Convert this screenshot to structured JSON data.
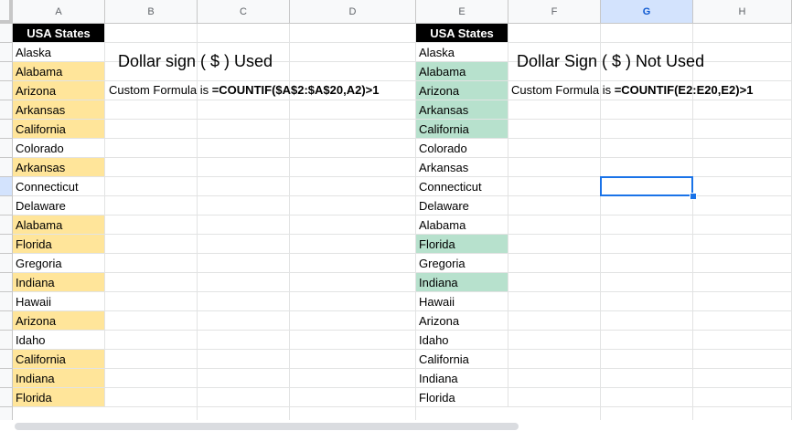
{
  "columns": [
    "A",
    "B",
    "C",
    "D",
    "E",
    "F",
    "G",
    "H"
  ],
  "selected_column": "G",
  "selected_row_index": 8,
  "column_a": {
    "header": "USA States",
    "states": [
      "Alaska",
      "Alabama",
      "Arizona",
      "Arkansas",
      "California",
      "Colorado",
      "Arkansas",
      "Connecticut",
      "Delaware",
      "Alabama",
      "Florida",
      "Gregoria",
      "Indiana",
      "Hawaii",
      "Arizona",
      "Idaho",
      "California",
      "Indiana",
      "Florida"
    ],
    "highlighted": [
      false,
      true,
      true,
      true,
      true,
      false,
      true,
      false,
      false,
      true,
      true,
      false,
      true,
      false,
      true,
      false,
      true,
      true,
      true
    ]
  },
  "column_e": {
    "header": "USA States",
    "states": [
      "Alaska",
      "Alabama",
      "Arizona",
      "Arkansas",
      "California",
      "Colorado",
      "Arkansas",
      "Connecticut",
      "Delaware",
      "Alabama",
      "Florida",
      "Gregoria",
      "Indiana",
      "Hawaii",
      "Arizona",
      "Idaho",
      "California",
      "Indiana",
      "Florida"
    ],
    "highlighted": [
      false,
      true,
      true,
      true,
      true,
      false,
      false,
      false,
      false,
      false,
      true,
      false,
      true,
      false,
      false,
      false,
      false,
      false,
      false
    ]
  },
  "left_note": {
    "title": "Dollar sign ( $ ) Used",
    "formula_prefix": "Custom Formula is ",
    "formula": "=COUNTIF($A$2:$A$20,A2)>1"
  },
  "right_note": {
    "title": "Dollar Sign ( $ ) Not Used",
    "formula_prefix": "Custom Formula is ",
    "formula": "=COUNTIF(E2:E20,E2)>1"
  },
  "colors": {
    "highlight_a": "#ffe59a",
    "highlight_e": "#b7e1cd",
    "header_bg": "#000000",
    "header_fg": "#ffffff",
    "selection": "#1a73e8"
  }
}
